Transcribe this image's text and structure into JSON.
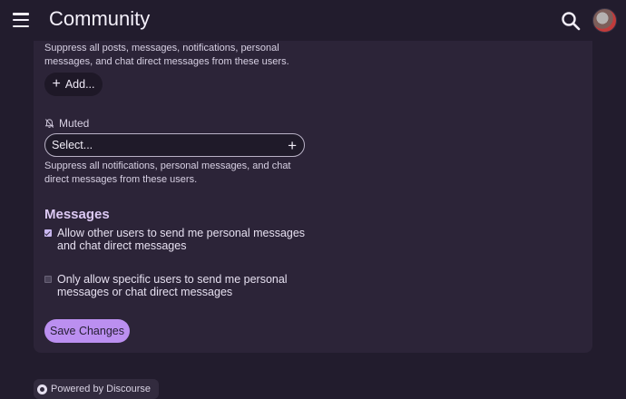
{
  "header": {
    "title": "Community",
    "menu_icon": "hamburger-icon",
    "search_icon": "search-icon",
    "avatar": "user-avatar"
  },
  "ignored": {
    "description": "Suppress all posts, messages, notifications, personal messages, and chat direct messages from these users.",
    "add_label": "Add..."
  },
  "muted": {
    "label": "Muted",
    "icon": "bell-slash-icon",
    "select_placeholder": "Select...",
    "description": "Suppress all notifications, personal messages, and chat direct messages from these users."
  },
  "messages": {
    "title": "Messages",
    "options": [
      {
        "label": "Allow other users to send me personal messages and chat direct messages",
        "checked": true
      },
      {
        "label": "Only allow specific users to send me personal messages or chat direct messages",
        "checked": false
      }
    ]
  },
  "actions": {
    "save_label": "Save Changes"
  },
  "footer": {
    "powered_by": "Powered by Discourse"
  },
  "colors": {
    "background": "#221c2d",
    "panel": "#2c2438",
    "accent": "#bb8ff0",
    "heading": "#dcc9f4"
  }
}
